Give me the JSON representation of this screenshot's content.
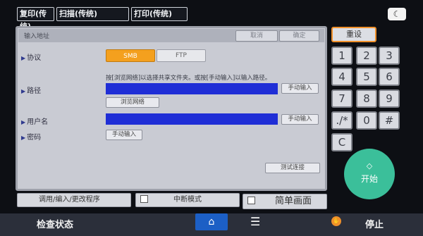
{
  "top_tabs": [
    {
      "label": "复印(传统)"
    },
    {
      "label": "扫描(传统)"
    },
    {
      "label": "打印(传统)"
    }
  ],
  "panel": {
    "title": "输入地址",
    "cancel": "取消",
    "confirm": "确定",
    "protocol_label": "协议",
    "protocol_options": [
      "SMB",
      "FTP"
    ],
    "protocol_selected": "SMB",
    "hint": "按[浏览网络]以选择共享文件夹。或按[手动输入]以输入路径。",
    "path_label": "路径",
    "browse_network": "浏览网络",
    "manual_input": "手动输入",
    "username_label": "用户名",
    "password_label": "密码",
    "test_connection": "测试连接"
  },
  "keypad": {
    "reset": "重设",
    "keys": [
      "1",
      "2",
      "3",
      "4",
      "5",
      "6",
      "7",
      "8",
      "9",
      "./*",
      "0",
      "#",
      "C"
    ],
    "start": "开始"
  },
  "bottom": {
    "program": "调用/编入/更改程序",
    "interrupt": "中断模式",
    "simple_screen": "简单画面"
  },
  "statusbar": {
    "check_status": "检查状态",
    "stop": "停止"
  },
  "colors": {
    "selected_option": "#f4a01e",
    "input_field": "#1f2ed6",
    "start_button": "#3bbf9a",
    "home_button": "#1c5fc5",
    "reset_border": "#f0902a"
  },
  "icons": [
    "moon-icon",
    "home-icon",
    "menu-icon",
    "stop-icon",
    "start-diamond-icon"
  ]
}
